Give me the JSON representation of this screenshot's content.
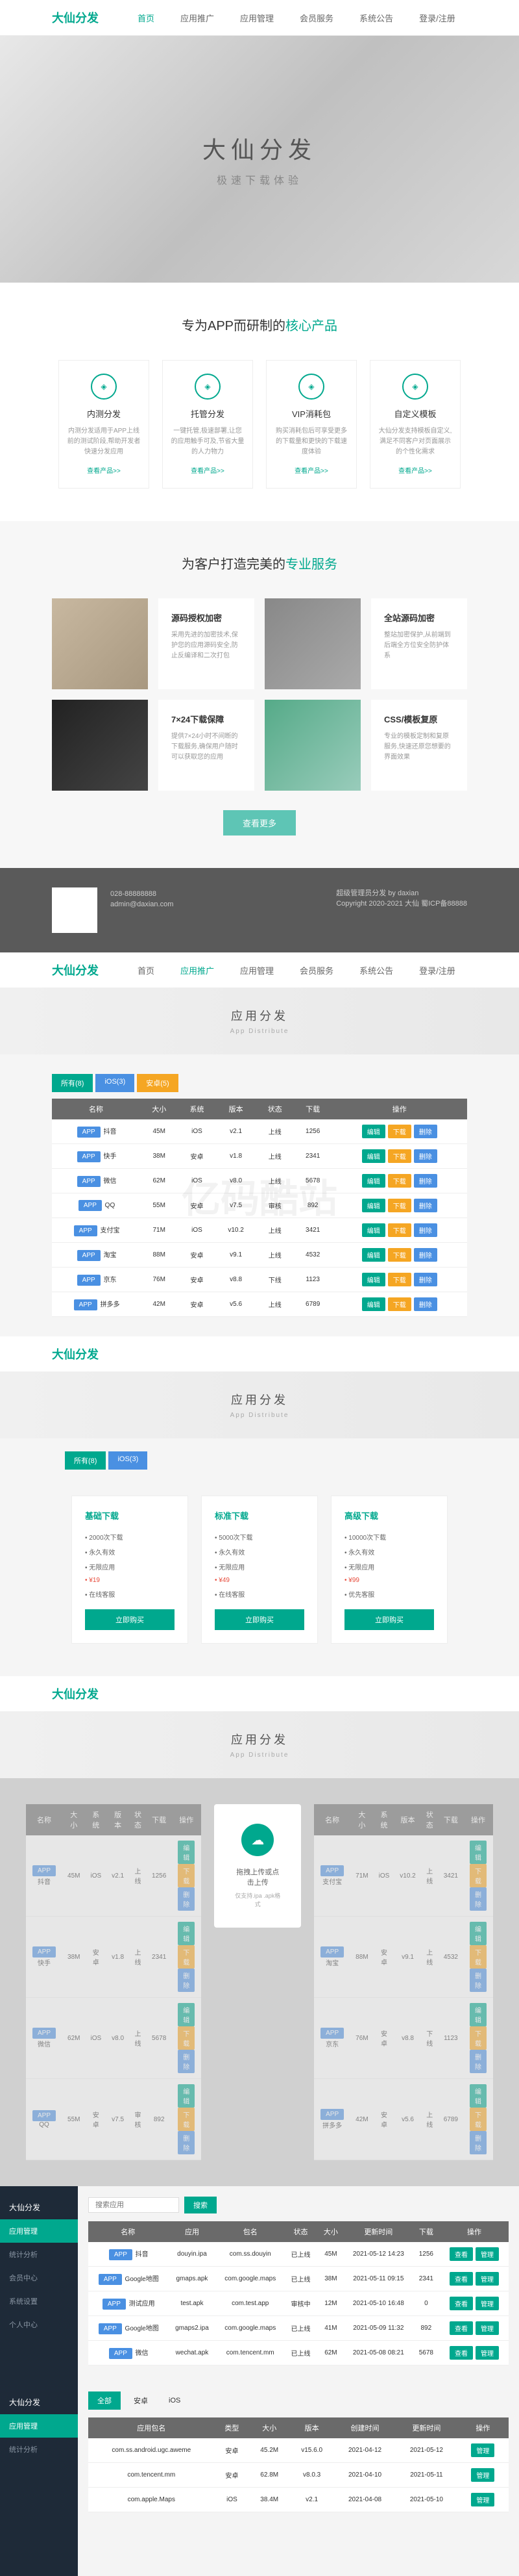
{
  "brand": "大仙分发",
  "nav": [
    "首页",
    "应用推广",
    "应用管理",
    "会员服务",
    "系统公告",
    "登录/注册"
  ],
  "hero": {
    "title": "大仙分发",
    "sub": "极速下载体验"
  },
  "products": {
    "heading_pre": "专为APP而研制的",
    "heading_hl": "核心产品",
    "items": [
      {
        "title": "内测分发",
        "desc": "内测分发适用于APP上线前的测试阶段,帮助开发者快速分发应用",
        "link": "查看产品>>"
      },
      {
        "title": "托管分发",
        "desc": "一键托管,极速部署,让您的应用触手可及,节省大量的人力物力",
        "link": "查看产品>>"
      },
      {
        "title": "VIP消耗包",
        "desc": "购买消耗包后可享受更多的下载量和更快的下载速度体验",
        "link": "查看产品>>"
      },
      {
        "title": "自定义模板",
        "desc": "大仙分发支持模板自定义,满足不同客户对页面展示的个性化需求",
        "link": "查看产品>>"
      }
    ]
  },
  "services": {
    "heading_pre": "为客户打造完美的",
    "heading_hl": "专业服务",
    "cards": [
      {
        "title": "源码授权加密",
        "desc": "采用先进的加密技术,保护您的应用源码安全,防止反编译和二次打包"
      },
      {
        "title": "全站源码加密",
        "desc": "整站加密保护,从前端到后端全方位安全防护体系"
      },
      {
        "title": "7×24下载保障",
        "desc": "提供7×24小时不间断的下载服务,确保用户随时可以获取您的应用"
      },
      {
        "title": "CSS/模板复原",
        "desc": "专业的模板定制和复原服务,快速还原您想要的界面效果"
      }
    ],
    "more": "查看更多"
  },
  "footer": {
    "phone": "028-88888888",
    "email": "admin@daxian.com",
    "right": "超级管理员分发 by daxian",
    "copy": "Copyright 2020-2021 大仙 蜀ICP备88888"
  },
  "dist": {
    "title": "应用分发",
    "sub": "App Distribute"
  },
  "tabs": [
    "所有(8)",
    "iOS(3)",
    "安卓(5)"
  ],
  "table": {
    "headers": [
      "名称",
      "大小",
      "系统",
      "版本",
      "状态",
      "下载",
      "操作"
    ],
    "rows": [
      {
        "name": "抖音",
        "size": "45M",
        "sys": "iOS",
        "ver": "v2.1",
        "status": "上线",
        "dl": "1256"
      },
      {
        "name": "快手",
        "size": "38M",
        "sys": "安卓",
        "ver": "v1.8",
        "status": "上线",
        "dl": "2341"
      },
      {
        "name": "微信",
        "size": "62M",
        "sys": "iOS",
        "ver": "v8.0",
        "status": "上线",
        "dl": "5678"
      },
      {
        "name": "QQ",
        "size": "55M",
        "sys": "安卓",
        "ver": "v7.5",
        "status": "审核",
        "dl": "892"
      },
      {
        "name": "支付宝",
        "size": "71M",
        "sys": "iOS",
        "ver": "v10.2",
        "status": "上线",
        "dl": "3421"
      },
      {
        "name": "淘宝",
        "size": "88M",
        "sys": "安卓",
        "ver": "v9.1",
        "status": "上线",
        "dl": "4532"
      },
      {
        "name": "京东",
        "size": "76M",
        "sys": "安卓",
        "ver": "v8.8",
        "status": "下线",
        "dl": "1123"
      },
      {
        "name": "拼多多",
        "size": "42M",
        "sys": "安卓",
        "ver": "v5.6",
        "status": "上线",
        "dl": "6789"
      }
    ],
    "actions": [
      "编辑",
      "下载",
      "删除"
    ]
  },
  "plans": [
    {
      "title": "基础下载",
      "items": [
        "2000次下载",
        "永久有效",
        "无限应用",
        "¥19",
        "在线客服"
      ],
      "btn": "立即购买"
    },
    {
      "title": "标准下载",
      "items": [
        "5000次下载",
        "永久有效",
        "无限应用",
        "¥49",
        "在线客服"
      ],
      "btn": "立即购买"
    },
    {
      "title": "高级下载",
      "items": [
        "10000次下载",
        "永久有效",
        "无限应用",
        "¥99",
        "优先客服"
      ],
      "btn": "立即购买"
    }
  ],
  "modal": {
    "title": "拖拽上传或点击上传",
    "sub": "仅支持.ipa .apk格式"
  },
  "admin": {
    "brand": "大仙分发",
    "menu": [
      "应用管理",
      "统计分析",
      "会员中心",
      "系统设置",
      "个人中心"
    ],
    "search": "搜索应用",
    "btn": "搜索",
    "headers": [
      "名称",
      "应用",
      "包名",
      "状态",
      "大小",
      "更新时间",
      "下载",
      "操作"
    ],
    "rows": [
      {
        "name": "抖音",
        "app": "douyin.ipa",
        "pkg": "com.ss.douyin",
        "status": "已上线",
        "size": "45M",
        "time": "2021-05-12 14:23",
        "dl": "1256"
      },
      {
        "name": "Google地图",
        "app": "gmaps.apk",
        "pkg": "com.google.maps",
        "status": "已上线",
        "size": "38M",
        "time": "2021-05-11 09:15",
        "dl": "2341"
      },
      {
        "name": "测试应用",
        "app": "test.apk",
        "pkg": "com.test.app",
        "status": "审核中",
        "size": "12M",
        "time": "2021-05-10 16:48",
        "dl": "0"
      },
      {
        "name": "Google地图",
        "app": "gmaps2.ipa",
        "pkg": "com.google.maps",
        "status": "已上线",
        "size": "41M",
        "time": "2021-05-09 11:32",
        "dl": "892"
      },
      {
        "name": "微信",
        "app": "wechat.apk",
        "pkg": "com.tencent.mm",
        "status": "已上线",
        "size": "62M",
        "time": "2021-05-08 08:21",
        "dl": "5678"
      }
    ],
    "actions": [
      "查看",
      "管理"
    ]
  },
  "admin2": {
    "tabs": [
      "全部",
      "安卓",
      "iOS"
    ],
    "headers": [
      "应用包名",
      "类型",
      "大小",
      "版本",
      "创建时间",
      "更新时间",
      "操作"
    ],
    "rows": [
      {
        "pkg": "com.ss.android.ugc.aweme",
        "type": "安卓",
        "size": "45.2M",
        "ver": "v15.6.0",
        "ct": "2021-04-12",
        "ut": "2021-05-12",
        "op": "管理"
      },
      {
        "pkg": "com.tencent.mm",
        "type": "安卓",
        "size": "62.8M",
        "ver": "v8.0.3",
        "ct": "2021-04-10",
        "ut": "2021-05-11",
        "op": "管理"
      },
      {
        "pkg": "com.apple.Maps",
        "type": "iOS",
        "size": "38.4M",
        "ver": "v2.1",
        "ct": "2021-04-08",
        "ut": "2021-05-10",
        "op": "管理"
      }
    ]
  }
}
